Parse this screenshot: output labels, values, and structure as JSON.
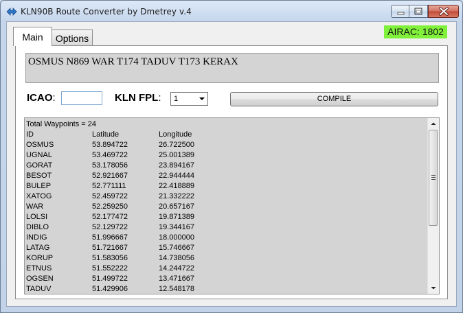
{
  "window": {
    "title": "KLN90B Route Converter by Dmetrey  v.4",
    "controls": {
      "minimize": "minimize-icon",
      "maximize": "maximize-icon",
      "close": "close-icon"
    }
  },
  "tabs": [
    {
      "label": "Main",
      "selected": true
    },
    {
      "label": "Options",
      "selected": false
    }
  ],
  "airac": {
    "text": "AIRAC: 1802",
    "color": "#80f03a"
  },
  "route": {
    "text": "OSMUS N869 WAR T174 TADUV T173 KERAX"
  },
  "form": {
    "icao_label": "ICAO",
    "icao_colon": ":",
    "icao_value": "",
    "kln_label": "KLN FPL",
    "kln_colon": ":",
    "kln_selected": "1",
    "compile_label": "COMPILE"
  },
  "waypoints": {
    "summary": "Total Waypoints = 24",
    "columns": [
      "ID",
      "Latitude",
      "Longitude"
    ],
    "rows": [
      [
        "OSMUS",
        "53.894722",
        "26.722500"
      ],
      [
        "UGNAL",
        "53.469722",
        "25.001389"
      ],
      [
        "GORAT",
        "53.178056",
        "23.894167"
      ],
      [
        "BESOT",
        "52.921667",
        "22.944444"
      ],
      [
        "BULEP",
        "52.771111",
        "22.418889"
      ],
      [
        "XATOG",
        "52.459722",
        "21.332222"
      ],
      [
        "WAR",
        "52.259250",
        "20.657167"
      ],
      [
        "LOLSI",
        "52.177472",
        "19.871389"
      ],
      [
        "DIBLO",
        "52.129722",
        "19.344167"
      ],
      [
        "INDIG",
        "51.996667",
        "18.000000"
      ],
      [
        "LATAG",
        "51.721667",
        "15.746667"
      ],
      [
        "KORUP",
        "51.583056",
        "14.738056"
      ],
      [
        "ETNUS",
        "51.552222",
        "14.244722"
      ],
      [
        "OGSEN",
        "51.499722",
        "13.471667"
      ],
      [
        "TADUV",
        "51.429906",
        "12.548178"
      ]
    ]
  }
}
